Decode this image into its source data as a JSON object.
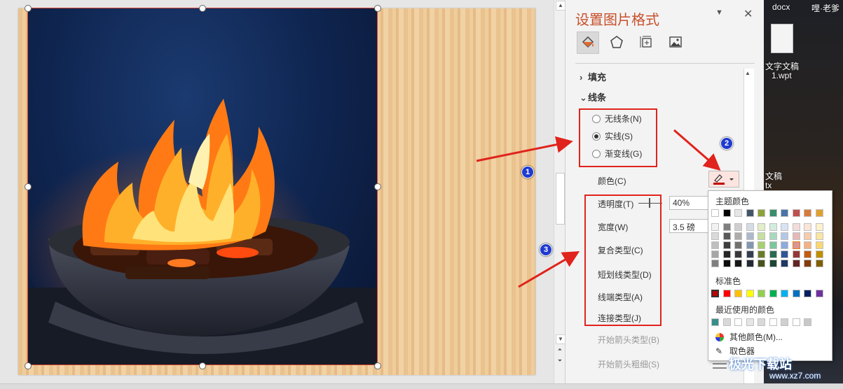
{
  "pane": {
    "title": "设置图片格式",
    "pin_glyph": "▼",
    "close_glyph": "✕",
    "tabs": [
      "fill-line-icon",
      "effects-icon",
      "size-position-icon",
      "picture-icon"
    ],
    "sections": {
      "fill": "填充",
      "line": "线条"
    },
    "line_options": {
      "none": "无线条(N)",
      "solid": "实线(S)",
      "gradient": "渐变线(G)",
      "selected": "solid"
    },
    "props": {
      "color": "颜色(C)",
      "transparency": "透明度(T)",
      "width": "宽度(W)",
      "compound": "复合类型(C)",
      "dash": "短划线类型(D)",
      "cap": "线端类型(A)",
      "join": "连接类型(J)",
      "begin_arrow_type": "开始箭头类型(B)",
      "begin_arrow_size": "开始箭头粗细(S)"
    },
    "values": {
      "transparency": "40%",
      "width": "3.5 磅"
    },
    "line_color": "#c00000"
  },
  "color_popup": {
    "theme_title": "主题颜色",
    "standard_title": "标准色",
    "recent_title": "最近使用的颜色",
    "more_colors": "其他颜色(M)...",
    "eyedropper": "取色器",
    "theme_colors": [
      "#ffffff",
      "#000000",
      "#e7e6e6",
      "#44546a",
      "#8da23a",
      "#3a8e6b",
      "#4a73a8",
      "#c0504d",
      "#d87a3a",
      "#e0a030"
    ],
    "theme_shades": [
      [
        "#f2f2f2",
        "#7f7f7f",
        "#d0cece",
        "#d6dce4",
        "#e2efc7",
        "#d3ecde",
        "#dae3f3",
        "#f2dcdb",
        "#fbe5d6",
        "#fdf2cc"
      ],
      [
        "#d9d9d9",
        "#595959",
        "#aeabab",
        "#adb9ca",
        "#c5e0a0",
        "#a8d9bd",
        "#b4c7e7",
        "#e6b9b8",
        "#f8cbad",
        "#fbe5a2"
      ],
      [
        "#bfbfbf",
        "#3f3f3f",
        "#757171",
        "#8497b0",
        "#a9d070",
        "#7cc69c",
        "#8faadc",
        "#d99694",
        "#f4b183",
        "#f9d872"
      ],
      [
        "#a6a6a6",
        "#262626",
        "#3a3838",
        "#333f50",
        "#6a7c29",
        "#2a6a50",
        "#2f5597",
        "#953734",
        "#c55a11",
        "#bf8f00"
      ],
      [
        "#7f7f7f",
        "#0c0c0c",
        "#171616",
        "#222a35",
        "#46531b",
        "#1c4635",
        "#1f3864",
        "#632523",
        "#843c0c",
        "#7f6000"
      ]
    ],
    "standard_colors": [
      "#c00000",
      "#ff0000",
      "#ffc000",
      "#ffff00",
      "#92d050",
      "#00b050",
      "#00b0f0",
      "#0070c0",
      "#002060",
      "#7030a0"
    ],
    "recent_colors": [
      "#3a8e8a",
      "#d9d9d9",
      "#ffffff",
      "#e6e6e6",
      "#d9d9d9",
      "#ffffff",
      "#d0d0d0",
      "#ffffff",
      "#c8c8c8"
    ]
  },
  "annotations": {
    "badge1": "1",
    "badge2": "2",
    "badge3": "3"
  },
  "desktop": {
    "item1": "docx",
    "item2": "哩·老爹",
    "file_label_1": "文字文稿",
    "file_label_2": "1.wpt",
    "file_label_3": "文稿",
    "file_label_4": "tx"
  },
  "watermark": {
    "text": "极光下载站",
    "url": "www.xz7.com"
  }
}
